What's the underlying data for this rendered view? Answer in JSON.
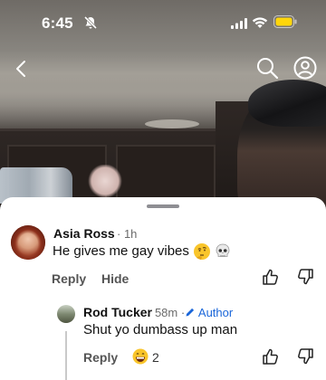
{
  "status_bar": {
    "time": "6:45"
  },
  "comments": [
    {
      "author": "Asia Ross",
      "age": "1h",
      "text": "He gives me gay vibes",
      "emojis": [
        "thinking-face",
        "skull"
      ],
      "actions": {
        "reply": "Reply",
        "hide": "Hide"
      }
    }
  ],
  "reply": {
    "author": "Rod Tucker",
    "age": "58m",
    "badge": "Author",
    "text": "Shut yo dumbass up man",
    "actions": {
      "reply": "Reply"
    },
    "reaction": {
      "emoji": "grinning-face",
      "count": "2"
    }
  },
  "colors": {
    "sheet_bg": "#ffffff",
    "author_badge": "#1a66d9",
    "meta_text": "#6b6b6b",
    "primary_text": "#111111"
  },
  "icons": {
    "top_bar": [
      "back-chevron-icon",
      "search-icon",
      "profile-icon"
    ],
    "status": [
      "bell-slash-icon",
      "signal-icon",
      "wifi-icon",
      "battery-icon"
    ],
    "comment_actions": [
      "thumbs-up-icon",
      "thumbs-down-icon"
    ]
  }
}
